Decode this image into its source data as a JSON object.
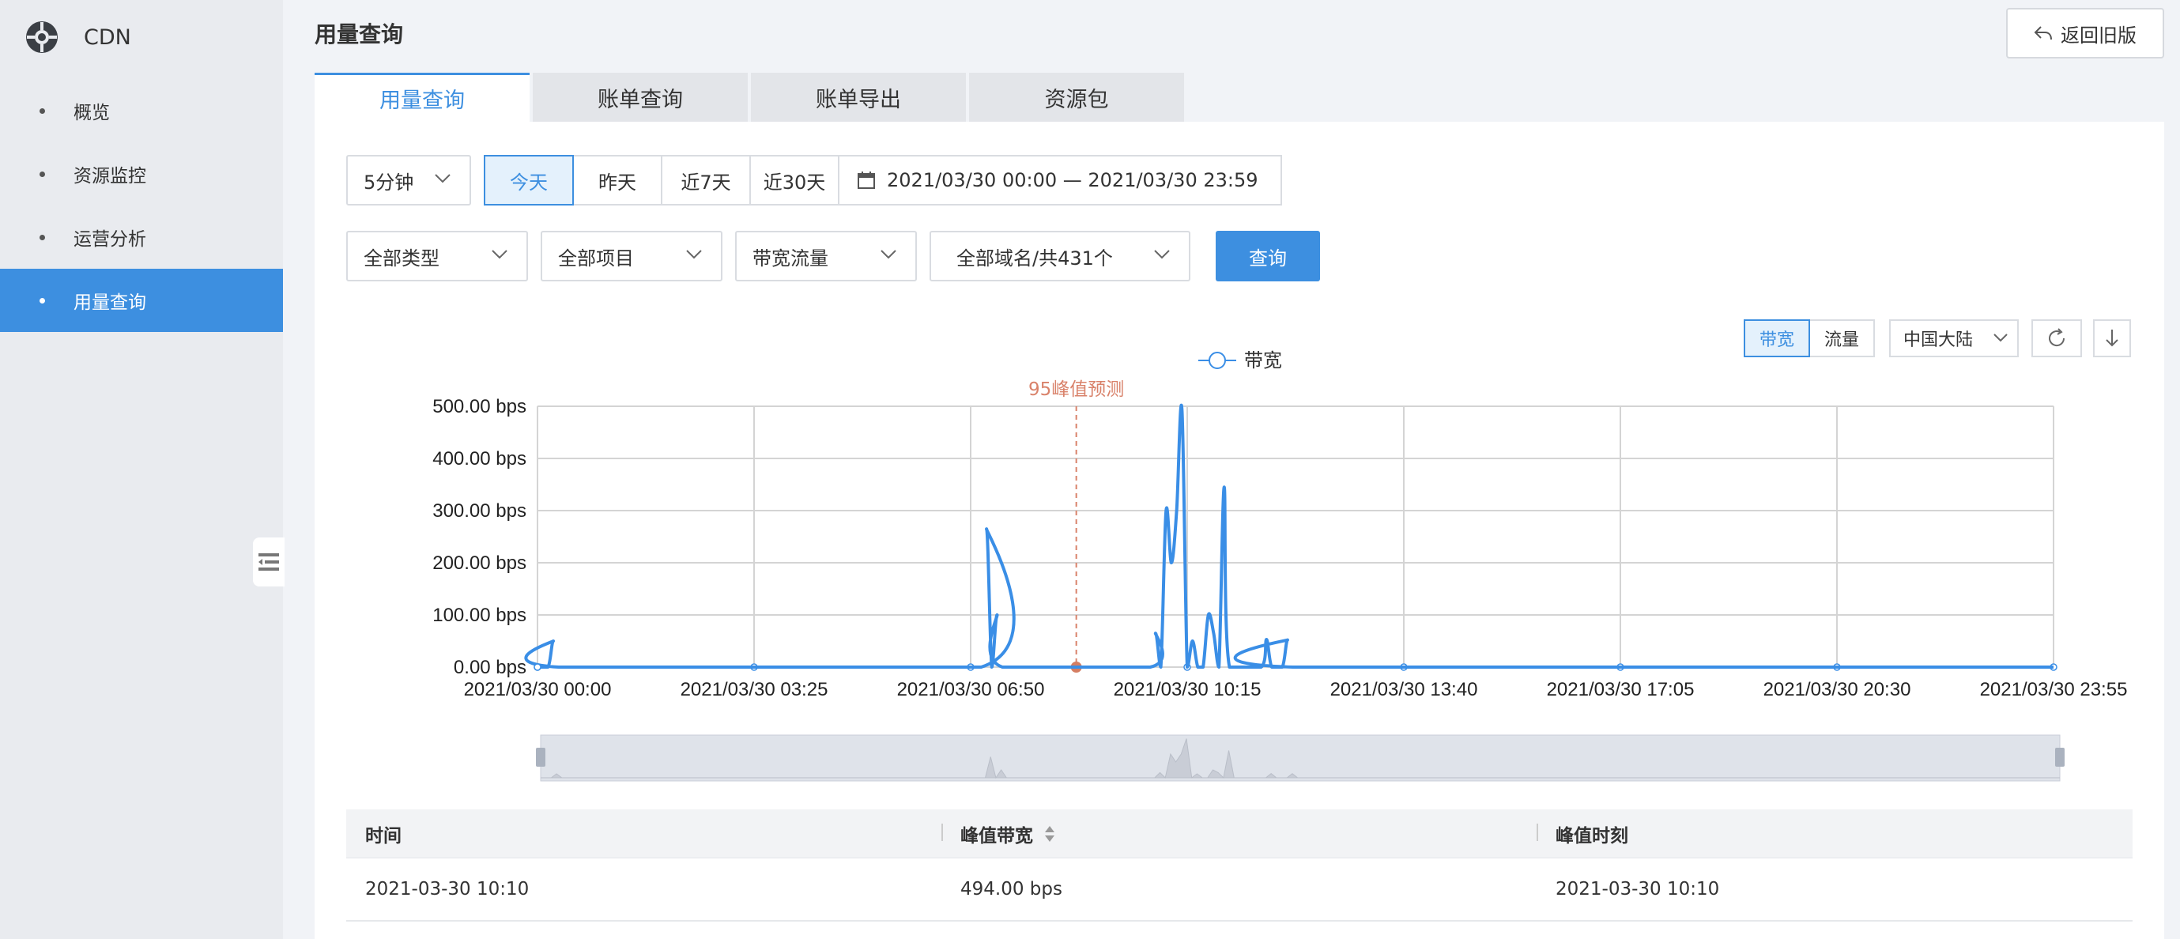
{
  "sidebar": {
    "brand": "CDN",
    "items": [
      {
        "label": "概览"
      },
      {
        "label": "资源监控"
      },
      {
        "label": "运营分析"
      },
      {
        "label": "用量查询"
      }
    ]
  },
  "header": {
    "title": "用量查询",
    "back_label": "返回旧版"
  },
  "tabs": [
    {
      "label": "用量查询"
    },
    {
      "label": "账单查询"
    },
    {
      "label": "账单导出"
    },
    {
      "label": "资源包"
    }
  ],
  "filters": {
    "interval": "5分钟",
    "quick_ranges": [
      "今天",
      "昨天",
      "近7天",
      "近30天"
    ],
    "date_range": "2021/03/30 00:00 — 2021/03/30 23:59",
    "type": "全部类型",
    "project": "全部项目",
    "metric": "带宽流量",
    "domain": "全部域名/共431个",
    "query_label": "查询"
  },
  "chart_toolbar": {
    "bandwidth_label": "带宽",
    "traffic_label": "流量",
    "region": "中国大陆"
  },
  "chart_data": {
    "type": "line",
    "legend": [
      "带宽"
    ],
    "legend_position": "top-center",
    "annotation": "95峰值预测",
    "annotation_x": "2021/03/30 08:30",
    "y_ticks": [
      "0.00 bps",
      "100.00 bps",
      "200.00 bps",
      "300.00 bps",
      "400.00 bps",
      "500.00 bps"
    ],
    "ylim": [
      0,
      500
    ],
    "x_ticks": [
      "2021/03/30 00:00",
      "2021/03/30 03:25",
      "2021/03/30 06:50",
      "2021/03/30 10:15",
      "2021/03/30 13:40",
      "2021/03/30 17:05",
      "2021/03/30 20:30",
      "2021/03/30 23:55"
    ],
    "grid": true,
    "series": [
      {
        "name": "带宽",
        "color": "#3a8ee6",
        "points": [
          [
            "00:00",
            0
          ],
          [
            "00:10",
            0
          ],
          [
            "00:15",
            50
          ],
          [
            "00:20",
            0
          ],
          [
            "07:00",
            0
          ],
          [
            "07:05",
            265
          ],
          [
            "07:10",
            0
          ],
          [
            "07:15",
            100
          ],
          [
            "07:20",
            0
          ],
          [
            "09:40",
            0
          ],
          [
            "09:45",
            65
          ],
          [
            "09:50",
            0
          ],
          [
            "09:55",
            300
          ],
          [
            "10:00",
            200
          ],
          [
            "10:05",
            300
          ],
          [
            "10:10",
            494
          ],
          [
            "10:15",
            0
          ],
          [
            "10:20",
            50
          ],
          [
            "10:25",
            0
          ],
          [
            "10:30",
            0
          ],
          [
            "10:35",
            100
          ],
          [
            "10:40",
            65
          ],
          [
            "10:45",
            0
          ],
          [
            "10:50",
            345
          ],
          [
            "10:55",
            0
          ],
          [
            "11:25",
            0
          ],
          [
            "11:30",
            53
          ],
          [
            "11:35",
            0
          ],
          [
            "11:45",
            0
          ],
          [
            "11:50",
            52
          ],
          [
            "11:55",
            0
          ],
          [
            "23:55",
            0
          ]
        ]
      }
    ]
  },
  "table": {
    "columns": [
      "时间",
      "峰值带宽",
      "峰值时刻"
    ],
    "rows": [
      [
        "2021-03-30 10:10",
        "494.00 bps",
        "2021-03-30 10:10"
      ]
    ]
  }
}
